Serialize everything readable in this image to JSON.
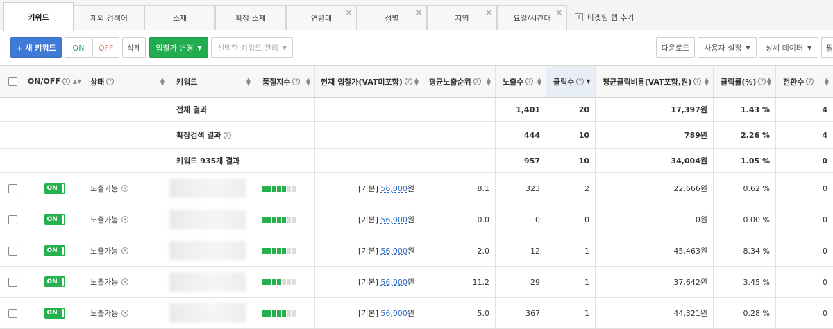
{
  "tabs": [
    {
      "label": "키워드",
      "active": true
    },
    {
      "label": "제외 검색어"
    },
    {
      "label": "소재"
    },
    {
      "label": "확장 소재"
    },
    {
      "label": "연령대",
      "closable": true
    },
    {
      "label": "성별",
      "closable": true
    },
    {
      "label": "지역",
      "closable": true
    },
    {
      "label": "요일/시간대",
      "closable": true
    }
  ],
  "add_tab_label": "타겟팅 탭 추가",
  "toolbar": {
    "new_keyword": "+ 새 키워드",
    "on": "ON",
    "off": "OFF",
    "delete": "삭제",
    "bid_change": "입찰가 변경",
    "manage_selected": "선택한 키워드 관리",
    "download": "다운로드",
    "user_settings": "사용자 설정",
    "detail_data": "상세 데이터",
    "filter_partial": "필"
  },
  "columns": {
    "onoff": "ON/OFF",
    "status": "상태",
    "keyword": "키워드",
    "quality": "품질지수",
    "bid": "현재 입찰가(VAT미포함)",
    "avg_rank": "평균노출순위",
    "impressions": "노출수",
    "clicks": "클릭수",
    "avg_cpc": "평균클릭비용(VAT포함,원)",
    "ctr": "클릭률(%)",
    "conversions": "전환수"
  },
  "summary_rows": [
    {
      "label": "전체 결과",
      "impressions": "1,401",
      "clicks": "20",
      "avg_cpc": "17,397원",
      "ctr": "1.43 %",
      "conversions": "4"
    },
    {
      "label": "확장검색 결과",
      "help": true,
      "impressions": "444",
      "clicks": "10",
      "avg_cpc": "789원",
      "ctr": "2.26 %",
      "conversions": "4"
    },
    {
      "label": "키워드 935개 결과",
      "impressions": "957",
      "clicks": "10",
      "avg_cpc": "34,004원",
      "ctr": "1.05 %",
      "conversions": "0"
    }
  ],
  "rows": [
    {
      "toggle": "ON",
      "status": "노출가능",
      "quality": 5,
      "bid_prefix": "[기본]",
      "bid": "56,000",
      "bid_unit": "원",
      "avg_rank": "8.1",
      "impressions": "323",
      "clicks": "2",
      "avg_cpc": "22,666원",
      "ctr": "0.62 %",
      "conversions": "0"
    },
    {
      "toggle": "ON",
      "status": "노출가능",
      "quality": 5,
      "bid_prefix": "[기본]",
      "bid": "56,000",
      "bid_unit": "원",
      "avg_rank": "0.0",
      "impressions": "0",
      "clicks": "0",
      "avg_cpc": "0원",
      "ctr": "0.00 %",
      "conversions": "0"
    },
    {
      "toggle": "ON",
      "status": "노출가능",
      "quality": 5,
      "bid_prefix": "[기본]",
      "bid": "56,000",
      "bid_unit": "원",
      "avg_rank": "2.0",
      "impressions": "12",
      "clicks": "1",
      "avg_cpc": "45,463원",
      "ctr": "8.34 %",
      "conversions": "0"
    },
    {
      "toggle": "ON",
      "status": "노출가능",
      "quality": 4,
      "bid_prefix": "[기본]",
      "bid": "56,000",
      "bid_unit": "원",
      "avg_rank": "11.2",
      "impressions": "29",
      "clicks": "1",
      "avg_cpc": "37,642원",
      "ctr": "3.45 %",
      "conversions": "0"
    },
    {
      "toggle": "ON",
      "status": "노출가능",
      "quality": 5,
      "bid_prefix": "[기본]",
      "bid": "56,000",
      "bid_unit": "원",
      "avg_rank": "5.0",
      "impressions": "367",
      "clicks": "1",
      "avg_cpc": "44,321원",
      "ctr": "0.28 %",
      "conversions": "0"
    }
  ]
}
